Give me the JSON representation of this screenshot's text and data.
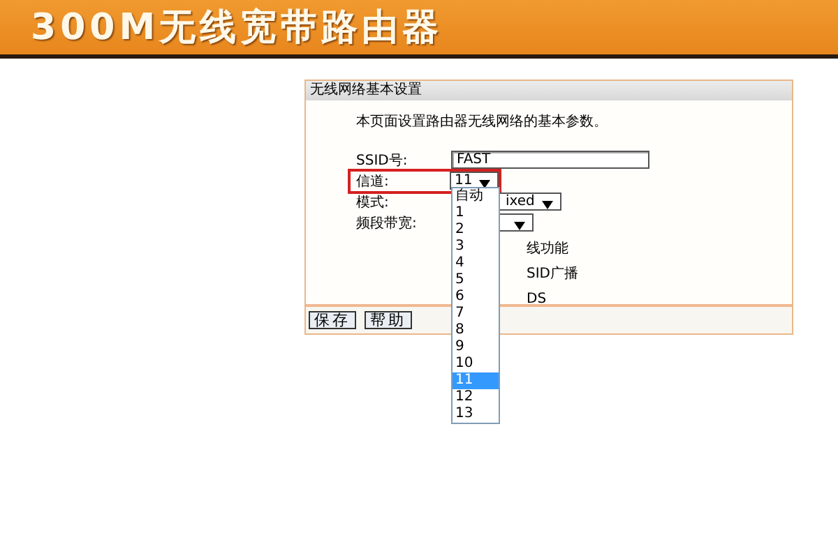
{
  "banner": {
    "title": "300M无线宽带路由器"
  },
  "panel": {
    "title": "无线网络基本设置",
    "intro": "本页面设置路由器无线网络的基本参数。",
    "fields": [
      {
        "kind": "text",
        "label": "SSID号:",
        "value": "FAST",
        "highlighted": false
      },
      {
        "kind": "select",
        "label": "信道:",
        "value": "11",
        "highlighted": true
      },
      {
        "kind": "select",
        "label": "模式:",
        "value": "ixed",
        "highlighted": false
      },
      {
        "kind": "select",
        "label": "频段带宽:",
        "highlighted": false
      }
    ],
    "option_lines": [
      "线功能",
      "SID广播",
      "DS"
    ],
    "buttons": [
      "保存",
      "帮助"
    ]
  },
  "dropdown": [
    {
      "label": "自动",
      "selected": false
    },
    {
      "label": "1",
      "selected": false
    },
    {
      "label": "2",
      "selected": false
    },
    {
      "label": "3",
      "selected": false
    },
    {
      "label": "4",
      "selected": false
    },
    {
      "label": "5",
      "selected": false
    },
    {
      "label": "6",
      "selected": false
    },
    {
      "label": "7",
      "selected": false
    },
    {
      "label": "8",
      "selected": false
    },
    {
      "label": "9",
      "selected": false
    },
    {
      "label": "10",
      "selected": false
    },
    {
      "label": "11",
      "selected": true
    },
    {
      "label": "12",
      "selected": false
    },
    {
      "label": "13",
      "selected": false
    }
  ]
}
